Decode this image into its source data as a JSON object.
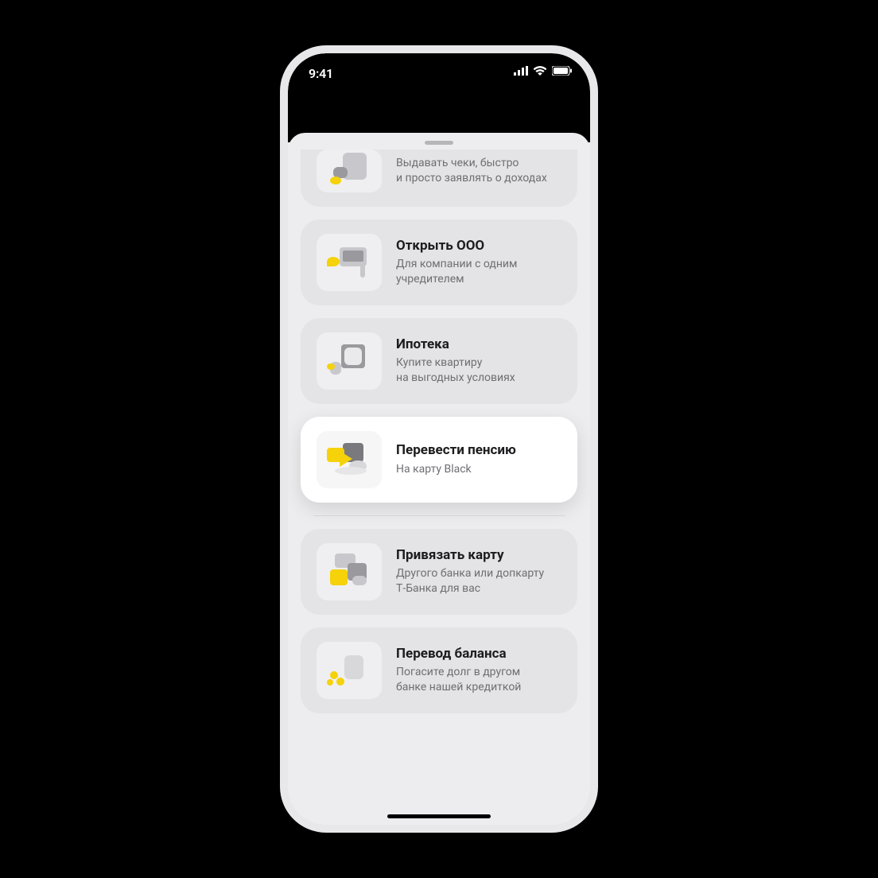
{
  "status": {
    "time": "9:41"
  },
  "cards": [
    {
      "title": "",
      "subtitle": "Выдавать чеки, быстро\nи просто заявлять о доходах"
    },
    {
      "title": "Открыть ООО",
      "subtitle": "Для компании с одним\nучредителем"
    },
    {
      "title": "Ипотека",
      "subtitle": "Купите квартиру\nна выгодных условиях"
    },
    {
      "title": "Перевести пенсию",
      "subtitle": "На карту Black"
    },
    {
      "title": "Привязать карту",
      "subtitle": "Другого банка или допкарту\nТ‑Банка для вас"
    },
    {
      "title": "Перевод баланса",
      "subtitle": "Погасите долг в другом\nбанке нашей кредиткой"
    }
  ]
}
